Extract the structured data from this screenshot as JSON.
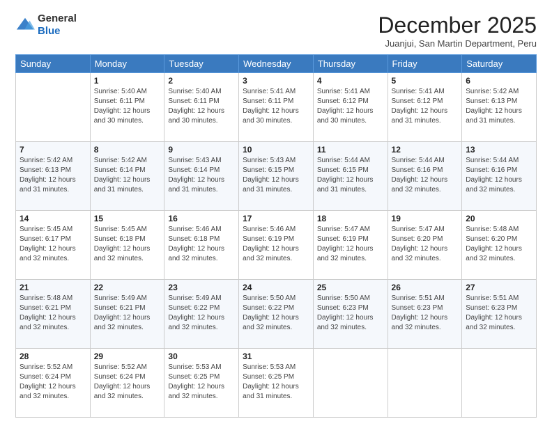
{
  "header": {
    "logo_general": "General",
    "logo_blue": "Blue",
    "month_title": "December 2025",
    "subtitle": "Juanjui, San Martin Department, Peru"
  },
  "days_of_week": [
    "Sunday",
    "Monday",
    "Tuesday",
    "Wednesday",
    "Thursday",
    "Friday",
    "Saturday"
  ],
  "weeks": [
    [
      {
        "day": "",
        "info": ""
      },
      {
        "day": "1",
        "info": "Sunrise: 5:40 AM\nSunset: 6:11 PM\nDaylight: 12 hours\nand 30 minutes."
      },
      {
        "day": "2",
        "info": "Sunrise: 5:40 AM\nSunset: 6:11 PM\nDaylight: 12 hours\nand 30 minutes."
      },
      {
        "day": "3",
        "info": "Sunrise: 5:41 AM\nSunset: 6:11 PM\nDaylight: 12 hours\nand 30 minutes."
      },
      {
        "day": "4",
        "info": "Sunrise: 5:41 AM\nSunset: 6:12 PM\nDaylight: 12 hours\nand 30 minutes."
      },
      {
        "day": "5",
        "info": "Sunrise: 5:41 AM\nSunset: 6:12 PM\nDaylight: 12 hours\nand 31 minutes."
      },
      {
        "day": "6",
        "info": "Sunrise: 5:42 AM\nSunset: 6:13 PM\nDaylight: 12 hours\nand 31 minutes."
      }
    ],
    [
      {
        "day": "7",
        "info": "Sunrise: 5:42 AM\nSunset: 6:13 PM\nDaylight: 12 hours\nand 31 minutes."
      },
      {
        "day": "8",
        "info": "Sunrise: 5:42 AM\nSunset: 6:14 PM\nDaylight: 12 hours\nand 31 minutes."
      },
      {
        "day": "9",
        "info": "Sunrise: 5:43 AM\nSunset: 6:14 PM\nDaylight: 12 hours\nand 31 minutes."
      },
      {
        "day": "10",
        "info": "Sunrise: 5:43 AM\nSunset: 6:15 PM\nDaylight: 12 hours\nand 31 minutes."
      },
      {
        "day": "11",
        "info": "Sunrise: 5:44 AM\nSunset: 6:15 PM\nDaylight: 12 hours\nand 31 minutes."
      },
      {
        "day": "12",
        "info": "Sunrise: 5:44 AM\nSunset: 6:16 PM\nDaylight: 12 hours\nand 32 minutes."
      },
      {
        "day": "13",
        "info": "Sunrise: 5:44 AM\nSunset: 6:16 PM\nDaylight: 12 hours\nand 32 minutes."
      }
    ],
    [
      {
        "day": "14",
        "info": "Sunrise: 5:45 AM\nSunset: 6:17 PM\nDaylight: 12 hours\nand 32 minutes."
      },
      {
        "day": "15",
        "info": "Sunrise: 5:45 AM\nSunset: 6:18 PM\nDaylight: 12 hours\nand 32 minutes."
      },
      {
        "day": "16",
        "info": "Sunrise: 5:46 AM\nSunset: 6:18 PM\nDaylight: 12 hours\nand 32 minutes."
      },
      {
        "day": "17",
        "info": "Sunrise: 5:46 AM\nSunset: 6:19 PM\nDaylight: 12 hours\nand 32 minutes."
      },
      {
        "day": "18",
        "info": "Sunrise: 5:47 AM\nSunset: 6:19 PM\nDaylight: 12 hours\nand 32 minutes."
      },
      {
        "day": "19",
        "info": "Sunrise: 5:47 AM\nSunset: 6:20 PM\nDaylight: 12 hours\nand 32 minutes."
      },
      {
        "day": "20",
        "info": "Sunrise: 5:48 AM\nSunset: 6:20 PM\nDaylight: 12 hours\nand 32 minutes."
      }
    ],
    [
      {
        "day": "21",
        "info": "Sunrise: 5:48 AM\nSunset: 6:21 PM\nDaylight: 12 hours\nand 32 minutes."
      },
      {
        "day": "22",
        "info": "Sunrise: 5:49 AM\nSunset: 6:21 PM\nDaylight: 12 hours\nand 32 minutes."
      },
      {
        "day": "23",
        "info": "Sunrise: 5:49 AM\nSunset: 6:22 PM\nDaylight: 12 hours\nand 32 minutes."
      },
      {
        "day": "24",
        "info": "Sunrise: 5:50 AM\nSunset: 6:22 PM\nDaylight: 12 hours\nand 32 minutes."
      },
      {
        "day": "25",
        "info": "Sunrise: 5:50 AM\nSunset: 6:23 PM\nDaylight: 12 hours\nand 32 minutes."
      },
      {
        "day": "26",
        "info": "Sunrise: 5:51 AM\nSunset: 6:23 PM\nDaylight: 12 hours\nand 32 minutes."
      },
      {
        "day": "27",
        "info": "Sunrise: 5:51 AM\nSunset: 6:23 PM\nDaylight: 12 hours\nand 32 minutes."
      }
    ],
    [
      {
        "day": "28",
        "info": "Sunrise: 5:52 AM\nSunset: 6:24 PM\nDaylight: 12 hours\nand 32 minutes."
      },
      {
        "day": "29",
        "info": "Sunrise: 5:52 AM\nSunset: 6:24 PM\nDaylight: 12 hours\nand 32 minutes."
      },
      {
        "day": "30",
        "info": "Sunrise: 5:53 AM\nSunset: 6:25 PM\nDaylight: 12 hours\nand 32 minutes."
      },
      {
        "day": "31",
        "info": "Sunrise: 5:53 AM\nSunset: 6:25 PM\nDaylight: 12 hours\nand 31 minutes."
      },
      {
        "day": "",
        "info": ""
      },
      {
        "day": "",
        "info": ""
      },
      {
        "day": "",
        "info": ""
      }
    ]
  ]
}
